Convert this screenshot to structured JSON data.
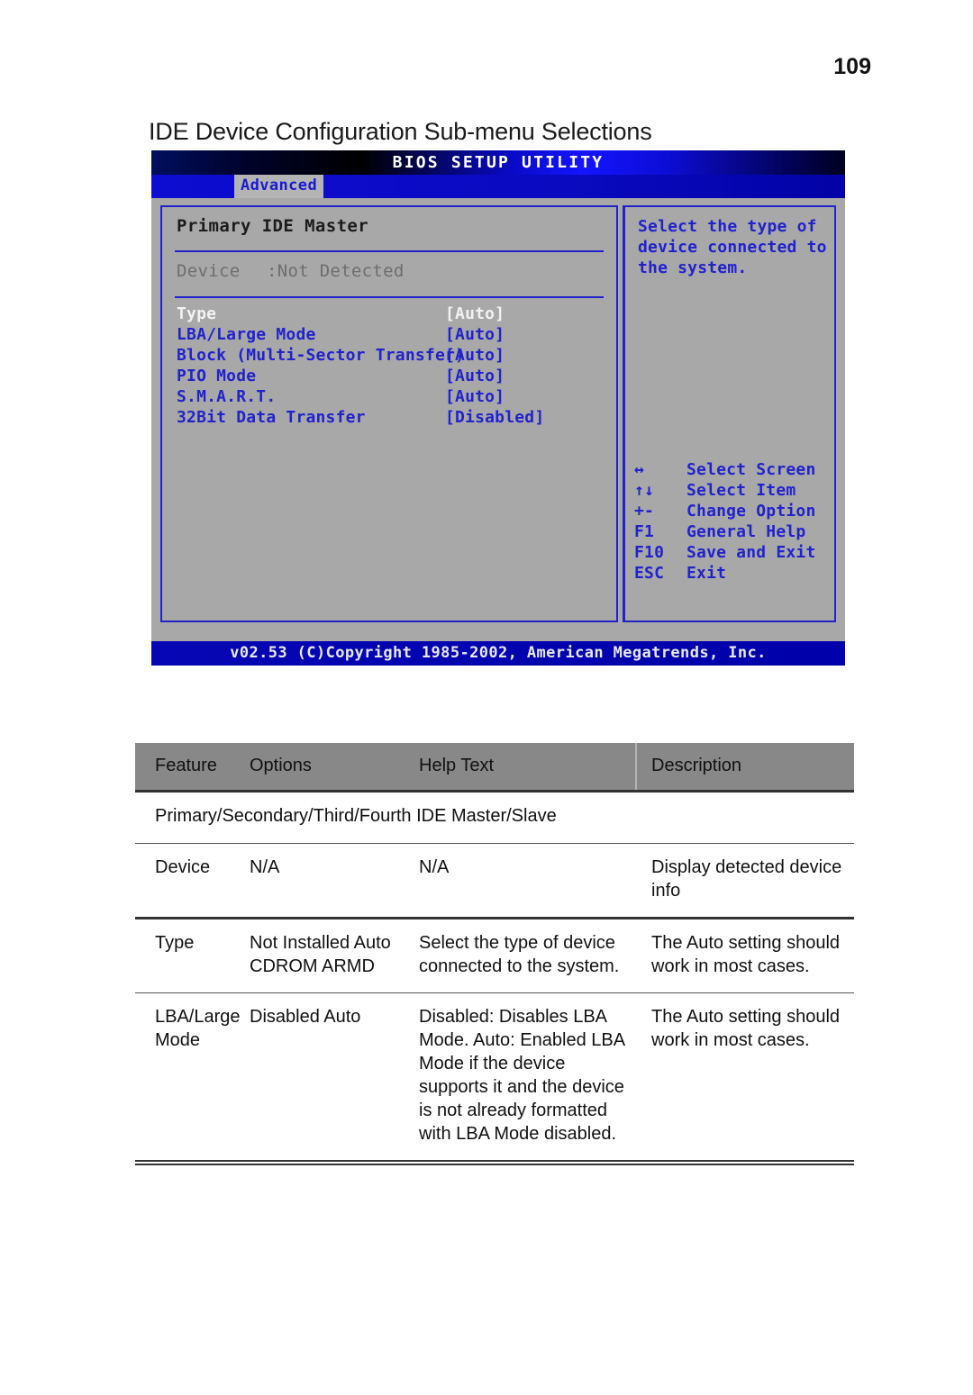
{
  "page": {
    "number": "109"
  },
  "heading": "IDE Device Configuration Sub-menu Selections",
  "bios": {
    "title": "BIOS SETUP UTILITY",
    "tab": "Advanced",
    "pane_heading": "Primary IDE Master",
    "device_label": "Device",
    "device_value": ":Not Detected",
    "options": [
      {
        "label": "Type",
        "value": "[Auto]",
        "selected": true
      },
      {
        "label": "LBA/Large Mode",
        "value": "[Auto]",
        "selected": false
      },
      {
        "label": "Block (Multi-Sector Transfer)",
        "value": "[Auto]",
        "selected": false
      },
      {
        "label": "PIO Mode",
        "value": "[Auto]",
        "selected": false
      },
      {
        "label": "S.M.A.R.T.",
        "value": "[Auto]",
        "selected": false
      },
      {
        "label": "32Bit Data Transfer",
        "value": "[Disabled]",
        "selected": false
      }
    ],
    "help_text": "Select the type\nof device connected\nto the system.",
    "keys": [
      {
        "key": "↔",
        "desc": "Select Screen"
      },
      {
        "key": "↑↓",
        "desc": "Select Item"
      },
      {
        "key": "+-",
        "desc": "Change Option"
      },
      {
        "key": "F1",
        "desc": "General Help"
      },
      {
        "key": "F10",
        "desc": "Save and Exit"
      },
      {
        "key": "ESC",
        "desc": "Exit"
      }
    ],
    "footer": "v02.53 (C)Copyright 1985-2002, American Megatrends, Inc."
  },
  "table": {
    "headers": [
      "Feature",
      "Options",
      "Help Text",
      "Description"
    ],
    "span_row": "Primary/Secondary/Third/Fourth IDE Master/Slave",
    "rows": [
      {
        "feature": "Device",
        "options": "N/A",
        "help": "N/A",
        "description": "Display detected\ndevice info"
      },
      {
        "feature": "Type",
        "options": "Not Installed\nAuto\nCDROM\nARMD",
        "help": "Select the type of\ndevice connected to\nthe system.",
        "description": "The Auto setting\nshould work in most\ncases."
      },
      {
        "feature": "LBA/Large\nMode",
        "options": "Disabled\nAuto",
        "help": "Disabled:  Disables\nLBA Mode.\nAuto:  Enabled LBA\nMode if the device\nsupports it and the\ndevice is not already\nformatted with LBA\nMode disabled.",
        "description": "The Auto setting\nshould work in most\ncases."
      }
    ]
  },
  "colors": {
    "bios_blue_text": "#2222cc",
    "bios_bg": "#a8a8a8",
    "banner_blue": "#1414ff",
    "table_header_gray": "#888888"
  }
}
